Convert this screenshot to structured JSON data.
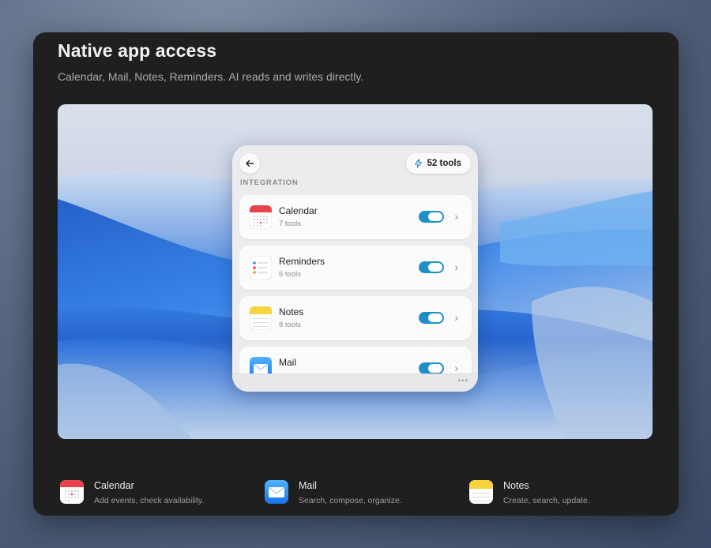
{
  "header": {
    "title": "Native app access",
    "subtitle": "Calendar, Mail, Notes, Reminders. AI reads and writes directly."
  },
  "panel": {
    "tools_badge": "52 tools",
    "section_label": "INTEGRATION",
    "items": [
      {
        "name": "Calendar",
        "count": "7 tools",
        "icon": "calendar-icon",
        "enabled": true
      },
      {
        "name": "Reminders",
        "count": "6 tools",
        "icon": "reminders-icon",
        "enabled": true
      },
      {
        "name": "Notes",
        "count": "8 tools",
        "icon": "notes-icon",
        "enabled": true
      },
      {
        "name": "Mail",
        "count": "",
        "icon": "mail-icon",
        "enabled": true
      }
    ]
  },
  "features": [
    {
      "name": "Calendar",
      "desc": "Add events, check availability.",
      "icon": "calendar-icon"
    },
    {
      "name": "Mail",
      "desc": "Search, compose, organize.",
      "icon": "mail-icon"
    },
    {
      "name": "Notes",
      "desc": "Create, search, update.",
      "icon": "notes-icon"
    }
  ],
  "colors": {
    "toggle_on": "#1f8fc7",
    "card_bg": "#1f1f1f",
    "calendar_red": "#e8434a",
    "notes_yellow": "#f7d33e",
    "mail_blue": "#2f8ef2"
  }
}
